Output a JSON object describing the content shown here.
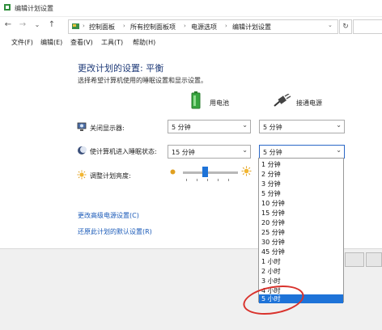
{
  "window": {
    "title": "编辑计划设置"
  },
  "nav": {
    "back": "←",
    "forward": "→",
    "dropdown": "⌄",
    "up": "↑"
  },
  "address": {
    "crumbs": [
      "控制面板",
      "所有控制面板项",
      "电源选项",
      "编辑计划设置"
    ],
    "separator": "›",
    "expand": "⌄",
    "refresh": "↻"
  },
  "menu": {
    "items": [
      "文件(F)",
      "编辑(E)",
      "查看(V)",
      "工具(T)",
      "帮助(H)"
    ]
  },
  "page": {
    "title": "更改计划的设置: 平衡",
    "subtitle": "选择希望计算机使用的睡眠设置和显示设置。"
  },
  "columns": {
    "battery": "用电池",
    "plugged": "接通电源"
  },
  "rows": {
    "display": {
      "label": "关闭显示器:",
      "battery": "5 分钟",
      "plugged": "5 分钟"
    },
    "sleep": {
      "label": "使计算机进入睡眠状态:",
      "battery": "15 分钟",
      "plugged": "5 分钟"
    },
    "brightness": {
      "label": "调整计划亮度:",
      "level": 0.4
    }
  },
  "dropdown": {
    "selected": "5 小时",
    "options": [
      "1 分钟",
      "2 分钟",
      "3 分钟",
      "5 分钟",
      "10 分钟",
      "15 分钟",
      "20 分钟",
      "25 分钟",
      "30 分钟",
      "45 分钟",
      "1 小时",
      "2 小时",
      "3 小时",
      "4 小时",
      "5 小时"
    ]
  },
  "links": {
    "advanced": "更改高级电源设置(C)",
    "restore": "还原此计划的默认设置(R)"
  },
  "icons": {
    "window": "power-plan-icon",
    "address": "control-panel-icon",
    "battery": "battery-icon",
    "plug": "power-plug-icon",
    "display": "monitor-icon",
    "sleep": "moon-icon",
    "brightness": "sun-icon"
  },
  "colors": {
    "accent": "#1e73d8",
    "title": "#1e3a78",
    "link": "#1a5ab8",
    "annotation": "#d9322c"
  }
}
